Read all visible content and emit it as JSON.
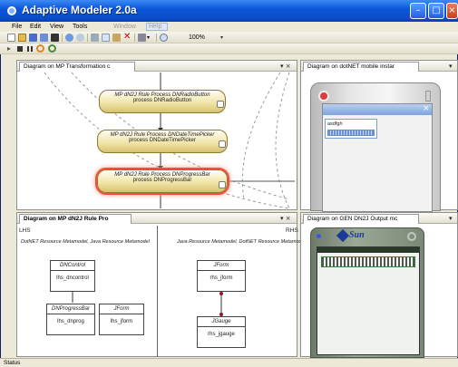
{
  "window": {
    "title": "Adaptive Modeler 2.0a",
    "buttons": {
      "minimize": "–",
      "maximize": "□",
      "close": "×"
    }
  },
  "menu": [
    "File",
    "Edit",
    "View",
    "Tools",
    "Window",
    "Help"
  ],
  "toolbar": {
    "zoom": "100%"
  },
  "panes": {
    "top_left": {
      "tab": "Diagram on MP Transformation c",
      "controls": "▾ ×",
      "nodes": [
        {
          "line1": "MP dN2J Rule Process DNRadioButton",
          "line2": "process DNRadioButton"
        },
        {
          "line1": "MP dN2J Rule Process DNDateTimePicker",
          "line2": "process DNDateTimePicker"
        },
        {
          "line1": "MP dN2J Rule Process DNProgressBar",
          "line2": "process DNProgressBar"
        }
      ]
    },
    "top_right": {
      "tab": "Diagram on dotNET mobile instar",
      "controls": "▾",
      "device_text": "asdfgh",
      "device_close": "×"
    },
    "bottom_left": {
      "tab": "Diagram on MP dN2J Rule Pro",
      "controls": "▾ ×",
      "lhs": "LHS",
      "rhs": "RHS",
      "lhs_meta": "DotNET Resource Metamodel, Java Resource Metamodel",
      "rhs_meta": "Java Resource Metamodel, DotNET Resource Metamodel",
      "boxes": [
        {
          "header": "DNControl",
          "body": "lhs_dncontrol"
        },
        {
          "header": "DNProgressBar",
          "body": "lhs_dnprog"
        },
        {
          "header": "JForm",
          "body": "lhs_jform"
        },
        {
          "header": "JForm",
          "body": "rhs_jform"
        },
        {
          "header": "JGauge",
          "body": "rhs_jgauge"
        }
      ]
    },
    "bottom_right": {
      "tab": "Diagram on GEN DN2J Output mc",
      "controls": "▾",
      "brand": "Sun"
    }
  },
  "status": {
    "text": "Status"
  },
  "colors": {
    "title_blue": "#0b57d8",
    "node_gold": "#efe2a4",
    "selection_red": "#ff4a3a"
  }
}
